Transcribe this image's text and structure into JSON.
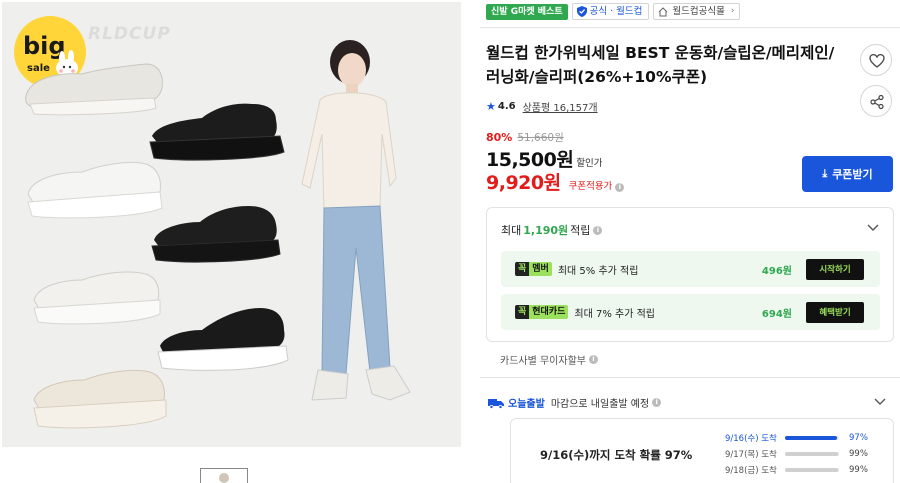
{
  "gallery": {
    "watermark": "RLDCUP",
    "sale_badge": {
      "line1": "big",
      "line2": "sale"
    },
    "shoe_colors": [
      "#e8e6e1",
      "#1c1c1c",
      "#f5f5f3",
      "#1e1e1e",
      "#f2f1ed",
      "#1a1a1a",
      "#ede6da"
    ]
  },
  "badges": {
    "best": "신발 G마켓 베스트",
    "official": "공식 · 월드컵",
    "store": "월드컵공식몰",
    "store_arrow": "›"
  },
  "product": {
    "title": "월드컵 한가위빅세일 BEST 운동화/슬립온/메리제인/러닝화/슬리퍼(26%+10%쿠폰)",
    "rating": "4.6",
    "review_label": "상품평 16,157개"
  },
  "price": {
    "discount_rate": "80%",
    "original": "51,660원",
    "sale": "15,500원",
    "sale_label": "할인가",
    "coupon": "9,920원",
    "coupon_label": "쿠폰적용가",
    "coupon_button": "쿠폰받기"
  },
  "reward": {
    "prefix": "최대",
    "amount": "1,190원",
    "suffix": "적립",
    "items": [
      {
        "brand_k": "꼭",
        "brand_name": "멤버",
        "text": "최대 5% 추가 적립",
        "amount": "496원",
        "button": "시작하기"
      },
      {
        "brand_k": "꼭",
        "brand_name": "현대카드",
        "text": "최대 7% 추가 적립",
        "amount": "694원",
        "button": "혜택받기"
      }
    ],
    "card_installment": "카드사별 무이자할부"
  },
  "delivery": {
    "today": "오늘출발",
    "desc": "마감으로 내일출발 예정",
    "main": "9/16(수)까지 도착 확률 97%",
    "rows": [
      {
        "date": "9/16(수) 도착",
        "percent": 97,
        "label": "97%"
      },
      {
        "date": "9/17(목) 도착",
        "percent": 99,
        "label": "99%"
      },
      {
        "date": "9/18(금) 도착",
        "percent": 99,
        "label": "99%"
      }
    ]
  },
  "colors": {
    "accent": "#1a56db",
    "sale_red": "#e21b1b",
    "reward_green": "#2fa84f",
    "smile_lime": "#9be15d"
  }
}
